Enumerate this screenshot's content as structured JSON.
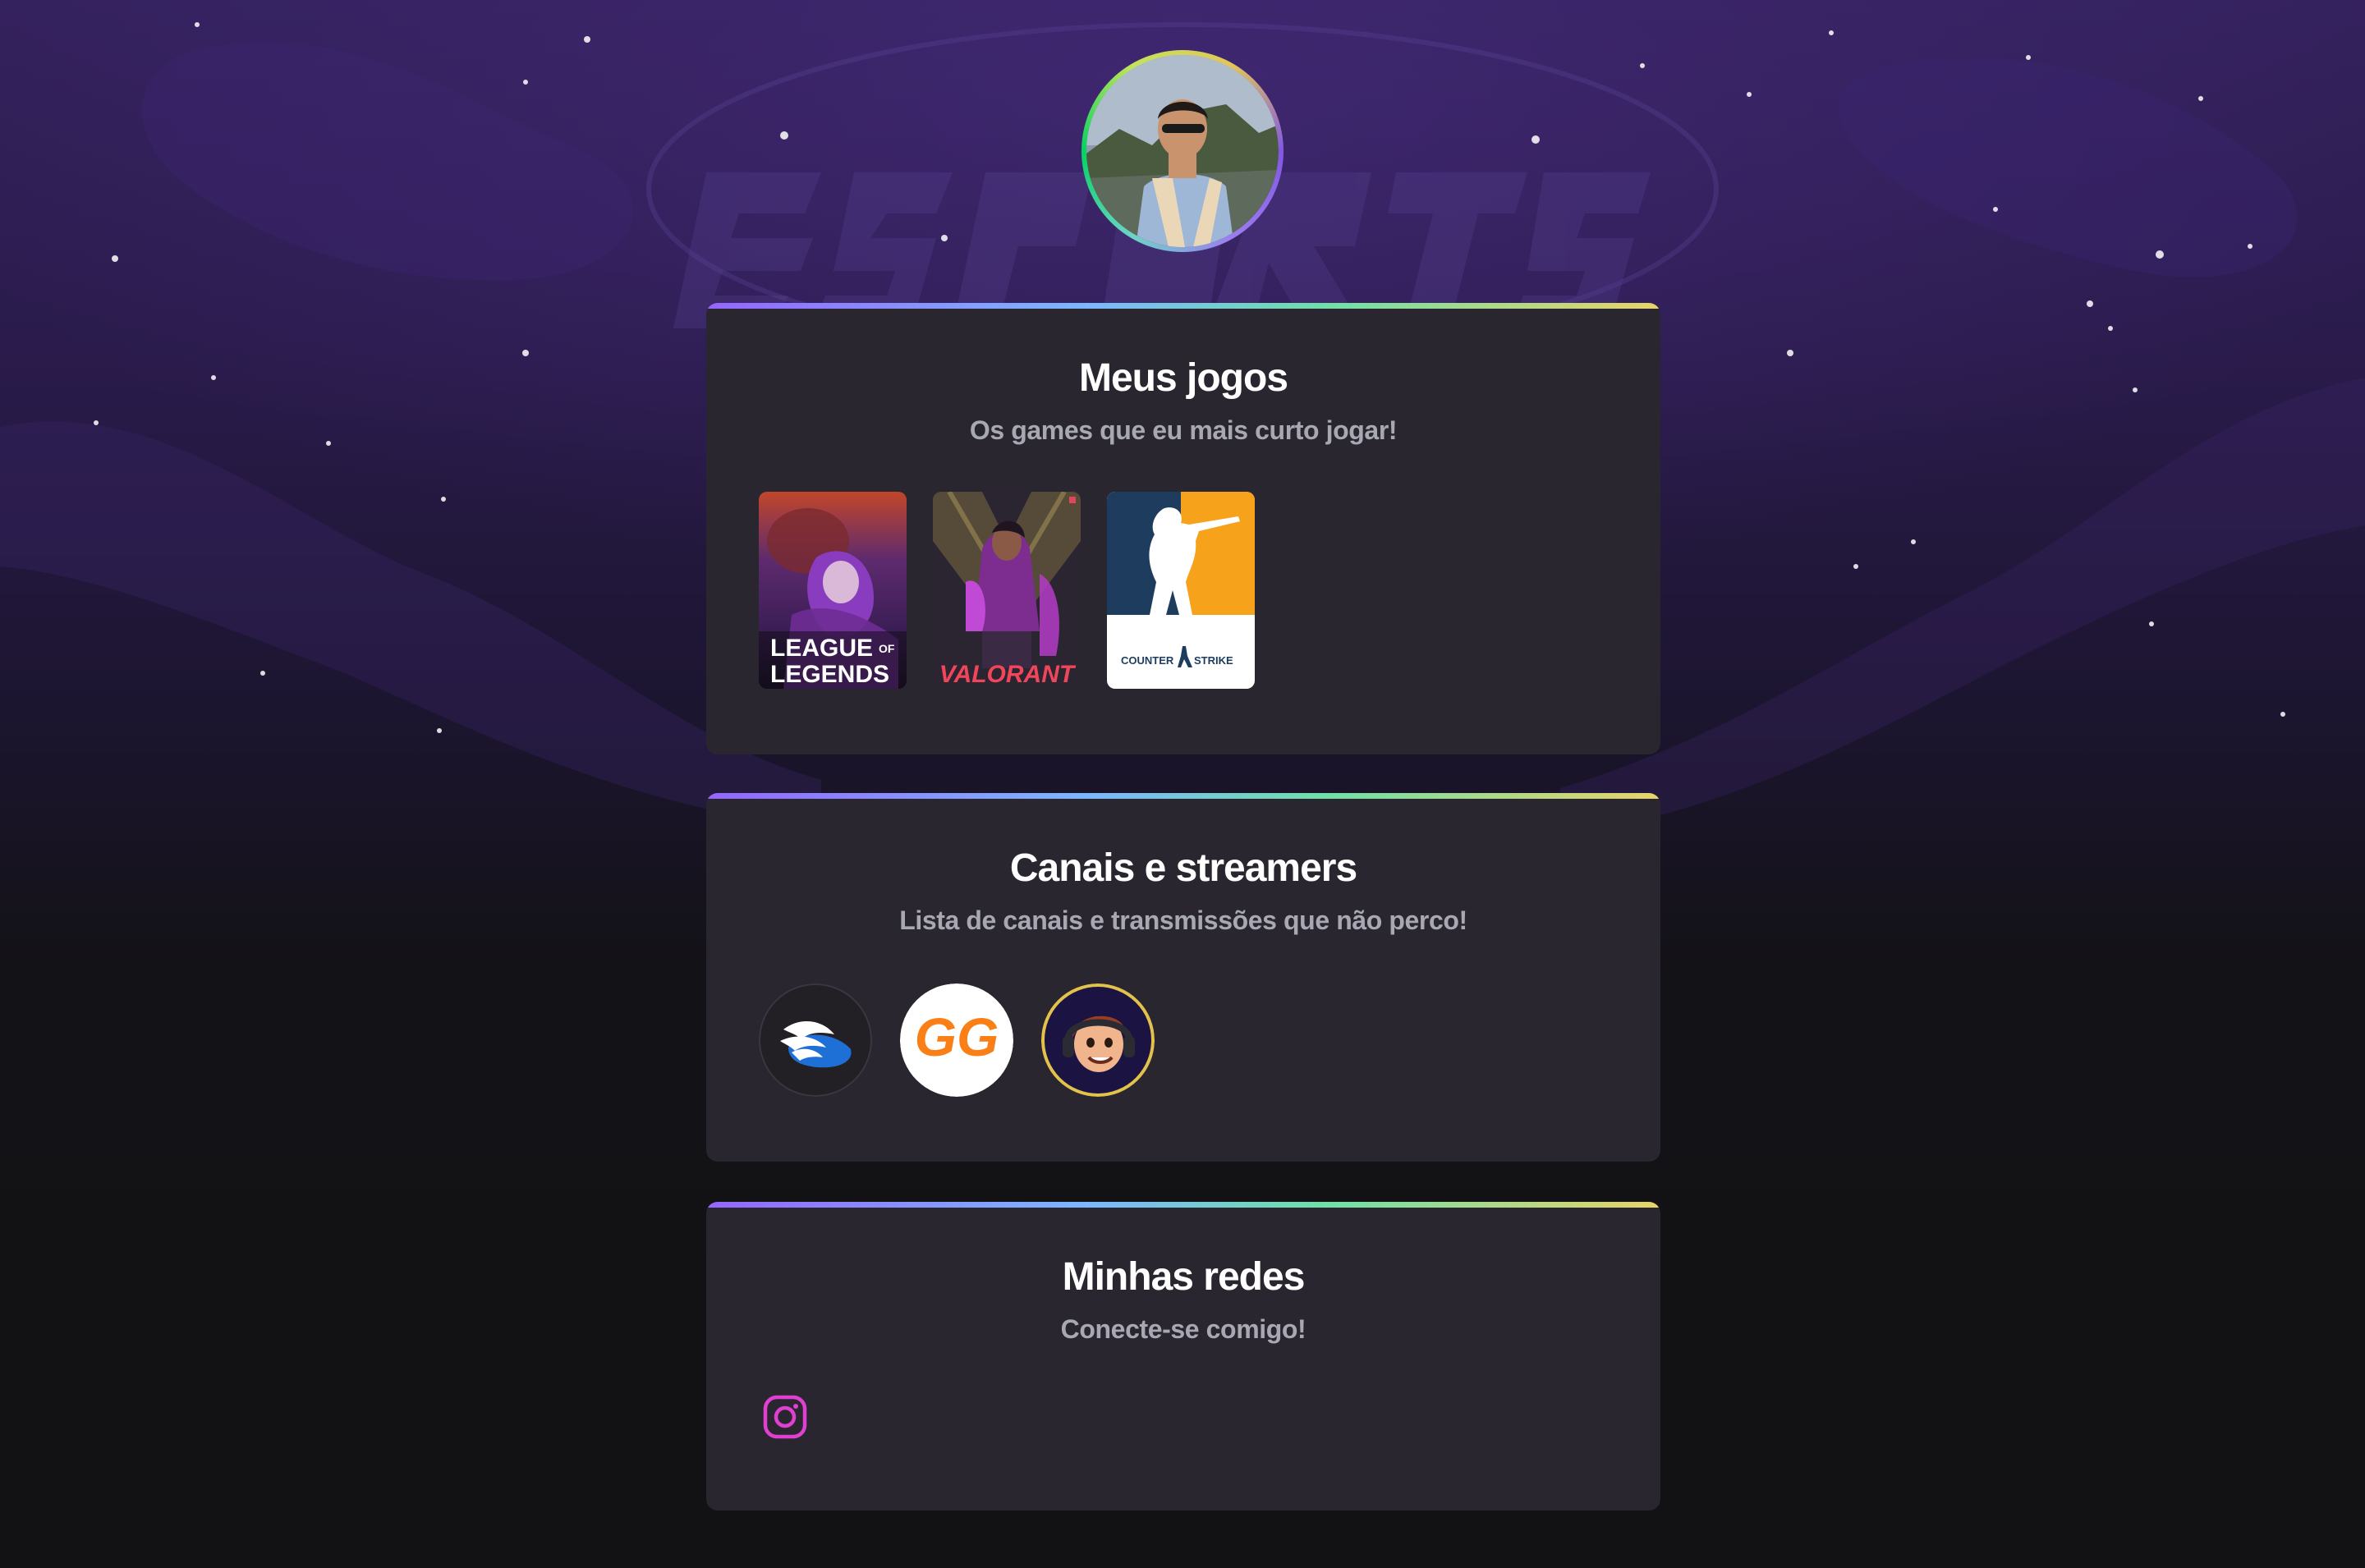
{
  "profile": {
    "avatar_alt": "Foto de perfil"
  },
  "sections": {
    "games": {
      "title": "Meus jogos",
      "subtitle": "Os games que eu mais curto jogar!",
      "items": [
        {
          "line1": "LEAGUE",
          "line1_small": "OF",
          "line2": "LEGENDS"
        },
        {
          "name": "VALORANT"
        },
        {
          "left": "COUNTER",
          "right": "STRIKE"
        }
      ]
    },
    "channels": {
      "title": "Canais e streamers",
      "subtitle": "Lista de canais e transmissões que não perco!",
      "items": [
        {
          "name": "wing-helmet-channel"
        },
        {
          "name": "GG"
        },
        {
          "name": "cartoon-streamer"
        }
      ]
    },
    "social": {
      "title": "Minhas redes",
      "subtitle": "Conecte-se comigo!",
      "items": [
        {
          "icon": "instagram-icon"
        }
      ]
    }
  },
  "colors": {
    "background": "#121214",
    "card": "#29262f",
    "title": "#ffffff",
    "subtitle": "#a8a8b3",
    "accent_gradient": [
      "#9466ff",
      "#7cb7ff",
      "#6fe0a8",
      "#e8d36a"
    ],
    "instagram": "#e040d0"
  }
}
